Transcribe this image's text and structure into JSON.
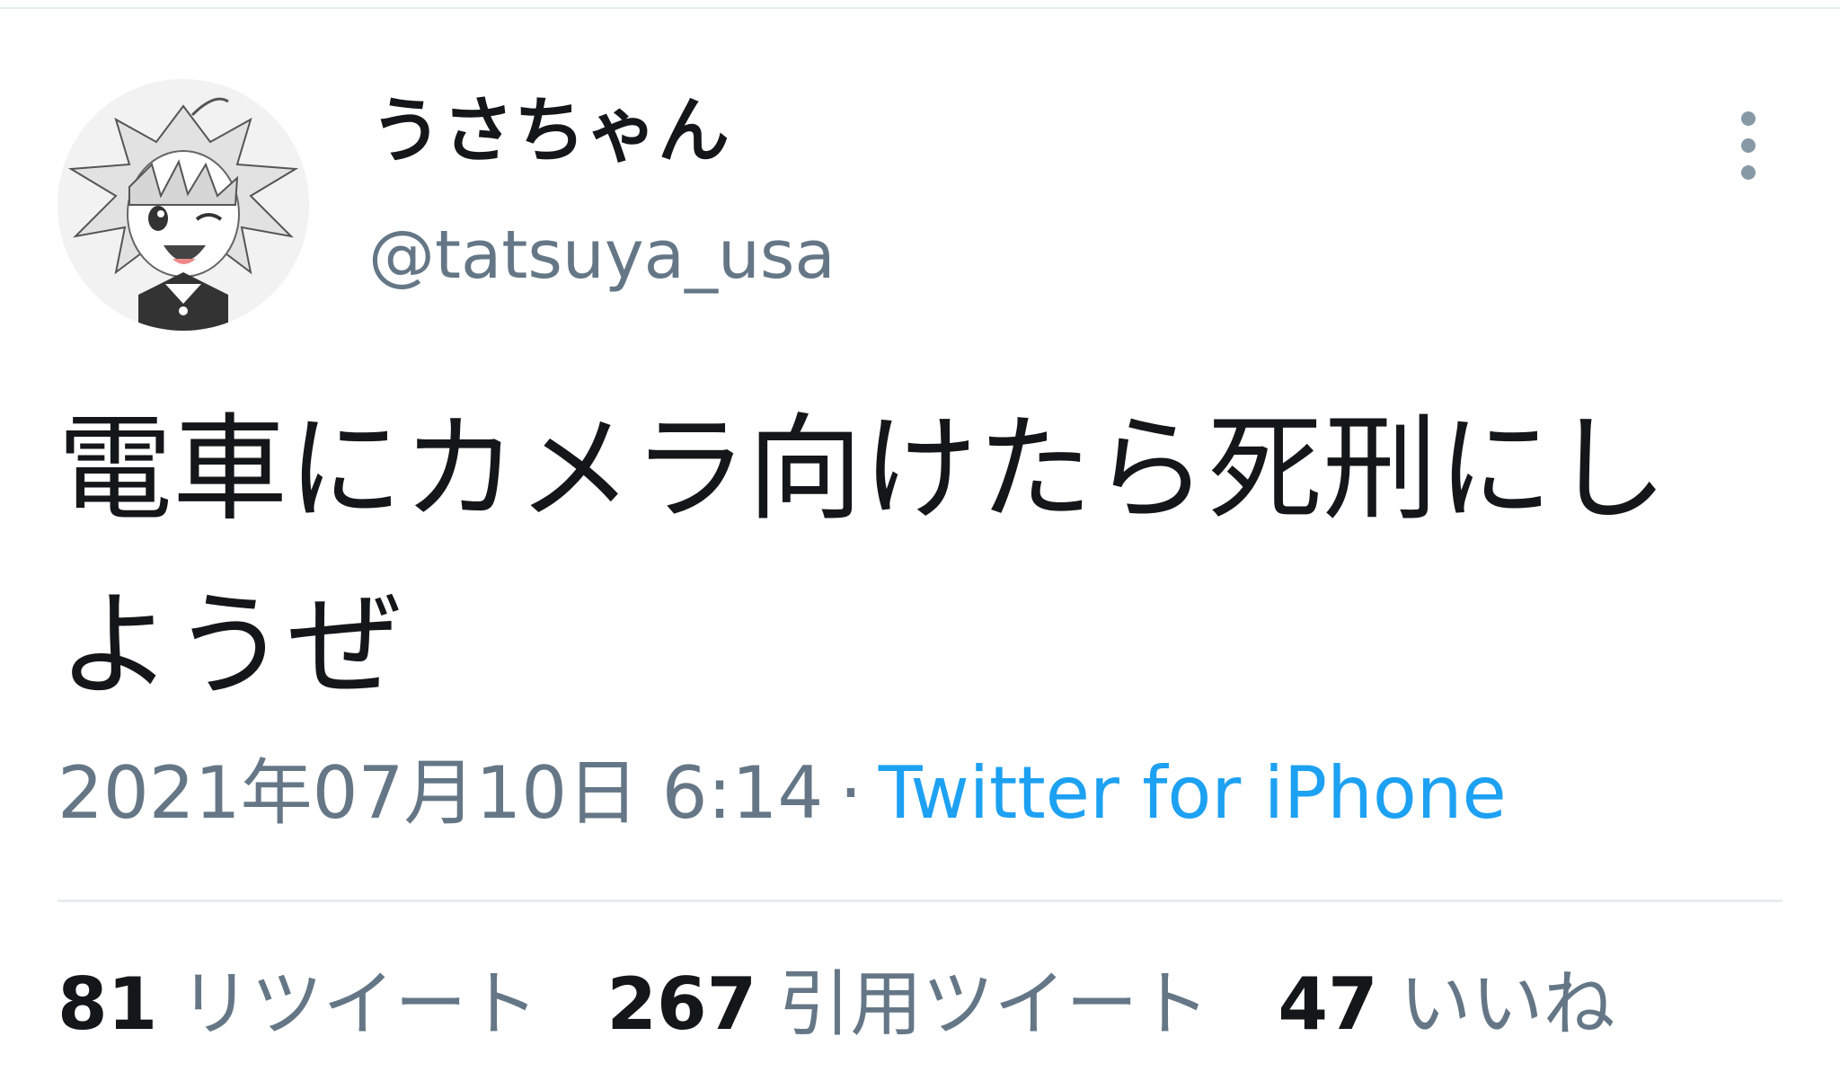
{
  "tweet": {
    "author": {
      "display_name": "うさちゃん",
      "handle": "@tatsuya_usa"
    },
    "menu_icon": "more-vertical-icon",
    "text": "電車にカメラ向けたら死刑にしようぜ",
    "timestamp": "2021年07月10日 6:14",
    "separator": "·",
    "source": "Twitter for iPhone",
    "stats": {
      "retweets": {
        "count": "81",
        "label": "リツイート"
      },
      "quote_tweets": {
        "count": "267",
        "label": "引用ツイート"
      },
      "likes": {
        "count": "47",
        "label": "いいね"
      }
    }
  },
  "colors": {
    "primary_text": "#14171a",
    "secondary_text": "#657786",
    "link": "#1da1f2",
    "divider": "#e6ecf0"
  }
}
